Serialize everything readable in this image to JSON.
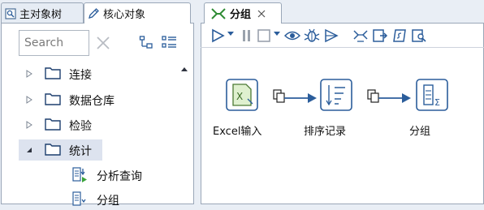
{
  "left_tabs": {
    "main_tree": "主对象树",
    "core_objects": "核心对象"
  },
  "search": {
    "placeholder": "Search"
  },
  "tree": {
    "nodes": [
      {
        "label": "连接"
      },
      {
        "label": "数据仓库"
      },
      {
        "label": "检验"
      },
      {
        "label": "统计"
      }
    ],
    "children": [
      {
        "label": "分析查询"
      },
      {
        "label": "分组"
      }
    ]
  },
  "editor": {
    "tab_title": "分组",
    "steps": [
      {
        "label": "Excel输入",
        "icon": "excel-input-icon"
      },
      {
        "label": "排序记录",
        "icon": "sort-records-icon"
      },
      {
        "label": "分组",
        "icon": "group-by-icon"
      }
    ]
  },
  "colors": {
    "accent_blue": "#2b5d9b",
    "step_green": "#4c7a34",
    "selection": "#dde3ef"
  }
}
